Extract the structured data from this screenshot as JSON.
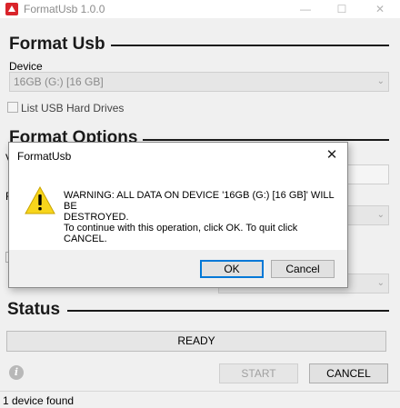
{
  "window": {
    "title": "FormatUsb 1.0.0",
    "controls": {
      "minimize": "—",
      "maximize": "☐",
      "close": "✕"
    }
  },
  "format_usb": {
    "heading": "Format Usb",
    "device_label": "Device",
    "device_value": "16GB (G:) [16 GB]",
    "list_usb_hard_drives_label": "List USB Hard Drives"
  },
  "format_options": {
    "heading": "Format Options",
    "partial_label_1": "V",
    "partial_label_2": "F"
  },
  "status": {
    "heading": "Status",
    "state": "READY"
  },
  "actions": {
    "start_label": "START",
    "cancel_label": "CANCEL"
  },
  "statusbar": {
    "text": "1 device found"
  },
  "dialog": {
    "title": "FormatUsb",
    "close": "✕",
    "message_line1": "WARNING: ALL DATA ON DEVICE '16GB (G:) [16 GB]' WILL BE",
    "message_line2": "DESTROYED.",
    "message_line3": "To continue with this operation, click OK. To quit click",
    "message_line4": "CANCEL.",
    "ok_label": "OK",
    "cancel_label": "Cancel"
  },
  "icons": {
    "app": "formatusb-app-icon",
    "warning": "warning-icon",
    "info": "info-icon"
  },
  "colors": {
    "window_bg": "#f0f0f0",
    "warning_yellow": "#f7d51b",
    "default_button_border": "#0078d7"
  }
}
